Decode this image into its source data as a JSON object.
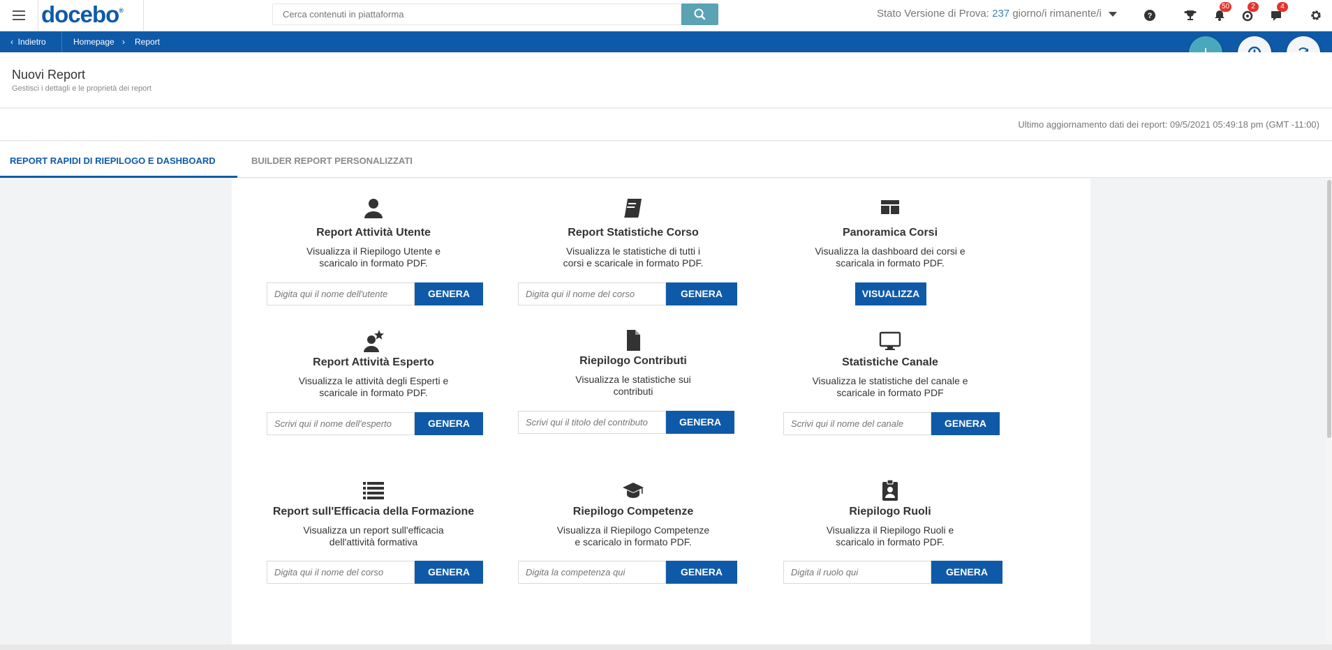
{
  "topbar": {
    "logo": "docebo",
    "logo_mark": "®",
    "search_placeholder": "Cerca contenuti in piattaforma",
    "trial_prefix": "Stato Versione di Prova:",
    "trial_days": "237",
    "trial_suffix": "giorno/i rimanente/i",
    "badges": {
      "notifications": "50",
      "gamification": "2",
      "messages": "4"
    }
  },
  "breadcrumb": {
    "back": "Indietro",
    "items": [
      "Homepage",
      "Report"
    ],
    "separator": "›"
  },
  "header": {
    "title": "Nuovi Report",
    "subtitle": "Gestisci i dettagli e le proprietà dei report",
    "last_update": "Ultimo aggiornamento dati dei report: 09/5/2021 05:49:18 pm (GMT -11:00)"
  },
  "tabs": [
    {
      "label": "REPORT RAPIDI DI RIEPILOGO E DASHBOARD"
    },
    {
      "label": "BUILDER REPORT PERSONALIZZATI"
    }
  ],
  "cards": [
    {
      "icon": "user-icon",
      "title": "Report Attività Utente",
      "desc1": "Visualizza il Riepilogo Utente e",
      "desc2": "scaricalo in formato PDF.",
      "placeholder": "Digita qui il nome dell'utente",
      "button": "GENERA"
    },
    {
      "icon": "book-icon",
      "title": "Report Statistiche Corso",
      "desc1": "Visualizza le statistiche di tutti i",
      "desc2": "corsi e scaricale in formato PDF.",
      "placeholder": "Digita qui il nome del corso",
      "button": "GENERA"
    },
    {
      "icon": "dashboard-layout-icon",
      "title": "Panoramica Corsi",
      "desc1": "Visualizza la dashboard dei corsi e",
      "desc2": "scaricala in formato PDF.",
      "button": "VISUALIZZA"
    },
    {
      "icon": "user-star-icon",
      "title": "Report Attività Esperto",
      "desc1": "Visualizza le attività degli Esperti e",
      "desc2": "scaricale in formato PDF.",
      "placeholder": "Scrivi qui il nome dell'esperto",
      "button": "GENERA"
    },
    {
      "icon": "file-icon",
      "title": "Riepilogo Contributi",
      "desc1": "Visualizza le statistiche sui",
      "desc2": "contributi",
      "placeholder": "Scrivi qui il titolo del contributo",
      "button": "GENERA"
    },
    {
      "icon": "monitor-icon",
      "title": "Statistiche Canale",
      "desc1": "Visualizza le statistiche del canale e",
      "desc2": "scaricale in formato PDF",
      "placeholder": "Scrivi qui il nome del canale",
      "button": "GENERA"
    },
    {
      "icon": "list-icon",
      "title": "Report sull'Efficacia della Formazione",
      "desc1": "Visualizza un report sull'efficacia",
      "desc2": "dell'attività formativa",
      "placeholder": "Digita qui il nome del corso",
      "button": "GENERA"
    },
    {
      "icon": "graduation-cap-icon",
      "title": "Riepilogo Competenze",
      "desc1": "Visualizza il Riepilogo Competenze",
      "desc2": "e scaricalo in formato PDF.",
      "placeholder": "Digita la competenza qui",
      "button": "GENERA"
    },
    {
      "icon": "id-badge-icon",
      "title": "Riepilogo Ruoli",
      "desc1": "Visualizza il Riepilogo Ruoli e",
      "desc2": "scaricalo in formato PDF.",
      "placeholder": "Digita il ruolo qui",
      "button": "GENERA"
    }
  ],
  "colors": {
    "brand": "#0f5aa8",
    "accent": "#4aa8bd",
    "badge": "#e3342f"
  }
}
